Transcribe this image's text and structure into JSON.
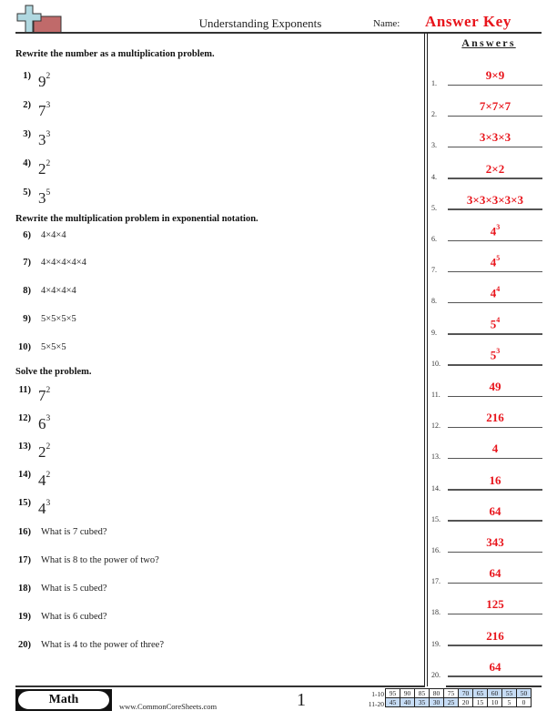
{
  "header": {
    "logo_icon": "plus-and-bar-logo",
    "title": "Understanding Exponents",
    "name_label": "Name:",
    "name_value": "Answer Key"
  },
  "sections": [
    {
      "heading": "Rewrite the number as a multiplication problem.",
      "questions": [
        {
          "num": "1)",
          "base": "9",
          "exp": "2"
        },
        {
          "num": "2)",
          "base": "7",
          "exp": "3"
        },
        {
          "num": "3)",
          "base": "3",
          "exp": "3"
        },
        {
          "num": "4)",
          "base": "2",
          "exp": "2"
        },
        {
          "num": "5)",
          "base": "3",
          "exp": "5"
        }
      ]
    },
    {
      "heading": "Rewrite the multiplication problem in exponential notation.",
      "questions": [
        {
          "num": "6)",
          "text": "4×4×4"
        },
        {
          "num": "7)",
          "text": "4×4×4×4×4"
        },
        {
          "num": "8)",
          "text": "4×4×4×4"
        },
        {
          "num": "9)",
          "text": "5×5×5×5"
        },
        {
          "num": "10)",
          "text": "5×5×5"
        }
      ]
    },
    {
      "heading": "Solve the problem.",
      "questions": [
        {
          "num": "11)",
          "base": "7",
          "exp": "2"
        },
        {
          "num": "12)",
          "base": "6",
          "exp": "3"
        },
        {
          "num": "13)",
          "base": "2",
          "exp": "2"
        },
        {
          "num": "14)",
          "base": "4",
          "exp": "2"
        },
        {
          "num": "15)",
          "base": "4",
          "exp": "3"
        },
        {
          "num": "16)",
          "text": "What is 7 cubed?"
        },
        {
          "num": "17)",
          "text": "What is 8 to the power of two?"
        },
        {
          "num": "18)",
          "text": "What is 5 cubed?"
        },
        {
          "num": "19)",
          "text": "What is 6 cubed?"
        },
        {
          "num": "20)",
          "text": "What is 4 to the power of three?"
        }
      ]
    }
  ],
  "answers": {
    "title": "Answers",
    "items": [
      {
        "num": "1.",
        "value": "9×9"
      },
      {
        "num": "2.",
        "value": "7×7×7"
      },
      {
        "num": "3.",
        "value": "3×3×3"
      },
      {
        "num": "4.",
        "value": "2×2"
      },
      {
        "num": "5.",
        "value": "3×3×3×3×3"
      },
      {
        "num": "6.",
        "base": "4",
        "exp": "3"
      },
      {
        "num": "7.",
        "base": "4",
        "exp": "5"
      },
      {
        "num": "8.",
        "base": "4",
        "exp": "4"
      },
      {
        "num": "9.",
        "base": "5",
        "exp": "4"
      },
      {
        "num": "10.",
        "base": "5",
        "exp": "3"
      },
      {
        "num": "11.",
        "value": "49"
      },
      {
        "num": "12.",
        "value": "216"
      },
      {
        "num": "13.",
        "value": "4"
      },
      {
        "num": "14.",
        "value": "16"
      },
      {
        "num": "15.",
        "value": "64"
      },
      {
        "num": "16.",
        "value": "343"
      },
      {
        "num": "17.",
        "value": "64"
      },
      {
        "num": "18.",
        "value": "125"
      },
      {
        "num": "19.",
        "value": "216"
      },
      {
        "num": "20.",
        "value": "64"
      }
    ]
  },
  "footer": {
    "subject": "Math",
    "website": "www.CommonCoreSheets.com",
    "page_number": "1",
    "score_rows": [
      {
        "label": "1-10",
        "scores": [
          "95",
          "90",
          "85",
          "80",
          "75",
          "70",
          "65",
          "60",
          "55",
          "50"
        ],
        "highlight": [
          false,
          false,
          false,
          false,
          false,
          true,
          true,
          true,
          true,
          true
        ]
      },
      {
        "label": "11-20",
        "scores": [
          "45",
          "40",
          "35",
          "30",
          "25",
          "20",
          "15",
          "10",
          "5",
          "0"
        ],
        "highlight": [
          true,
          true,
          true,
          true,
          true,
          false,
          false,
          false,
          false,
          false
        ]
      }
    ]
  },
  "colors": {
    "answer_red": "#e8141b",
    "score_highlight": "#c6dcf5",
    "logo_plus": "#b0d8e0",
    "logo_bar": "#c06a6a"
  }
}
